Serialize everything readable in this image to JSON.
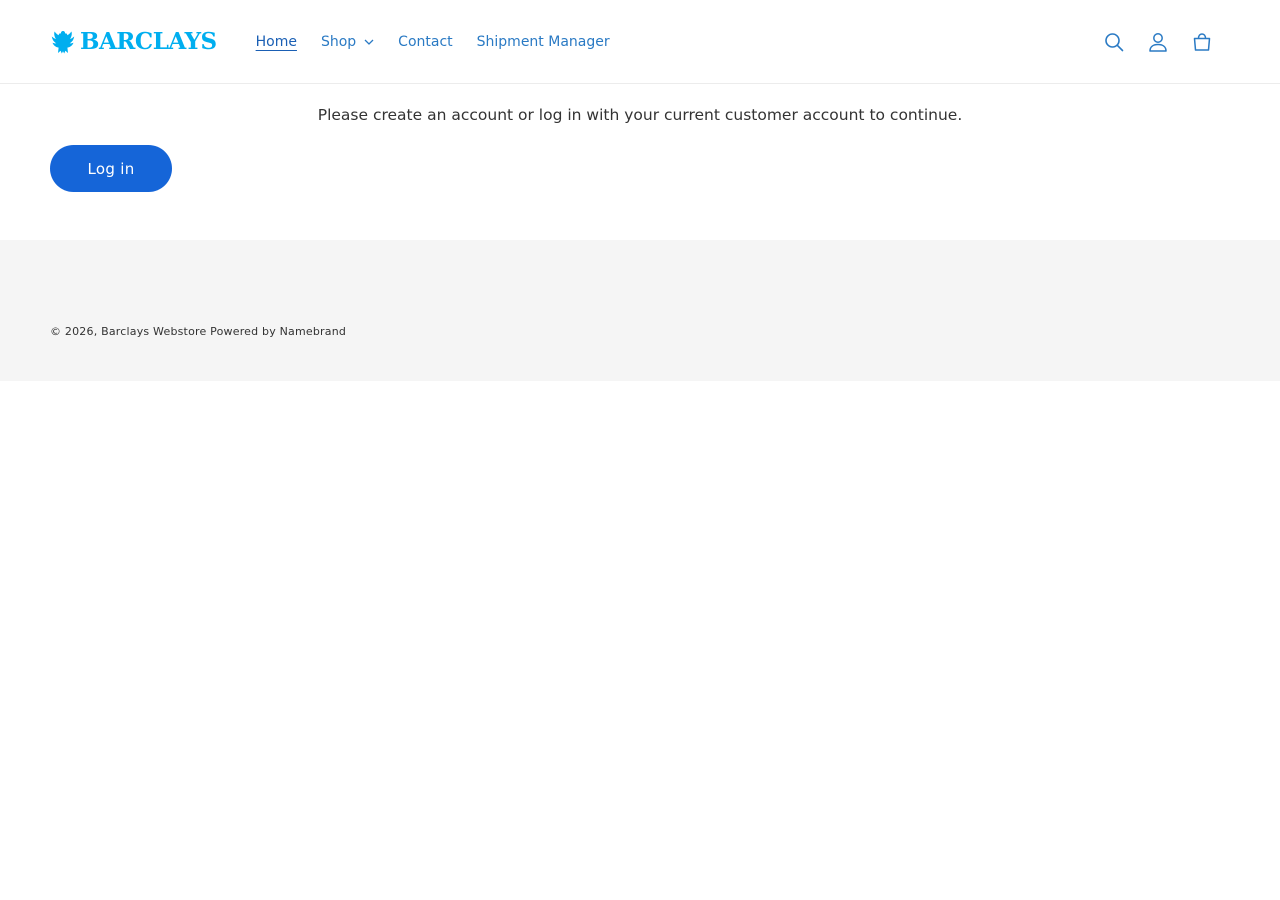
{
  "brand": {
    "name": "BARCLAYS",
    "color": "#00aeef"
  },
  "colors": {
    "nav_text": "#2a7ac4",
    "nav_active": "#1a5fb4",
    "button_bg": "#1565d8",
    "icon": "#2a7ac4"
  },
  "nav": {
    "items": [
      {
        "label": "Home",
        "active": true
      },
      {
        "label": "Shop",
        "has_dropdown": true,
        "icon": "chevron-down-icon"
      },
      {
        "label": "Contact"
      },
      {
        "label": "Shipment Manager"
      }
    ]
  },
  "header_icons": [
    "search-icon",
    "account-icon",
    "cart-icon"
  ],
  "main": {
    "message": "Please create an account or log in with your current customer account to continue.",
    "login_label": "Log in"
  },
  "footer": {
    "copyright_prefix": "© 2026,",
    "store_name": "Barclays Webstore",
    "powered_by": "Powered by Namebrand"
  }
}
